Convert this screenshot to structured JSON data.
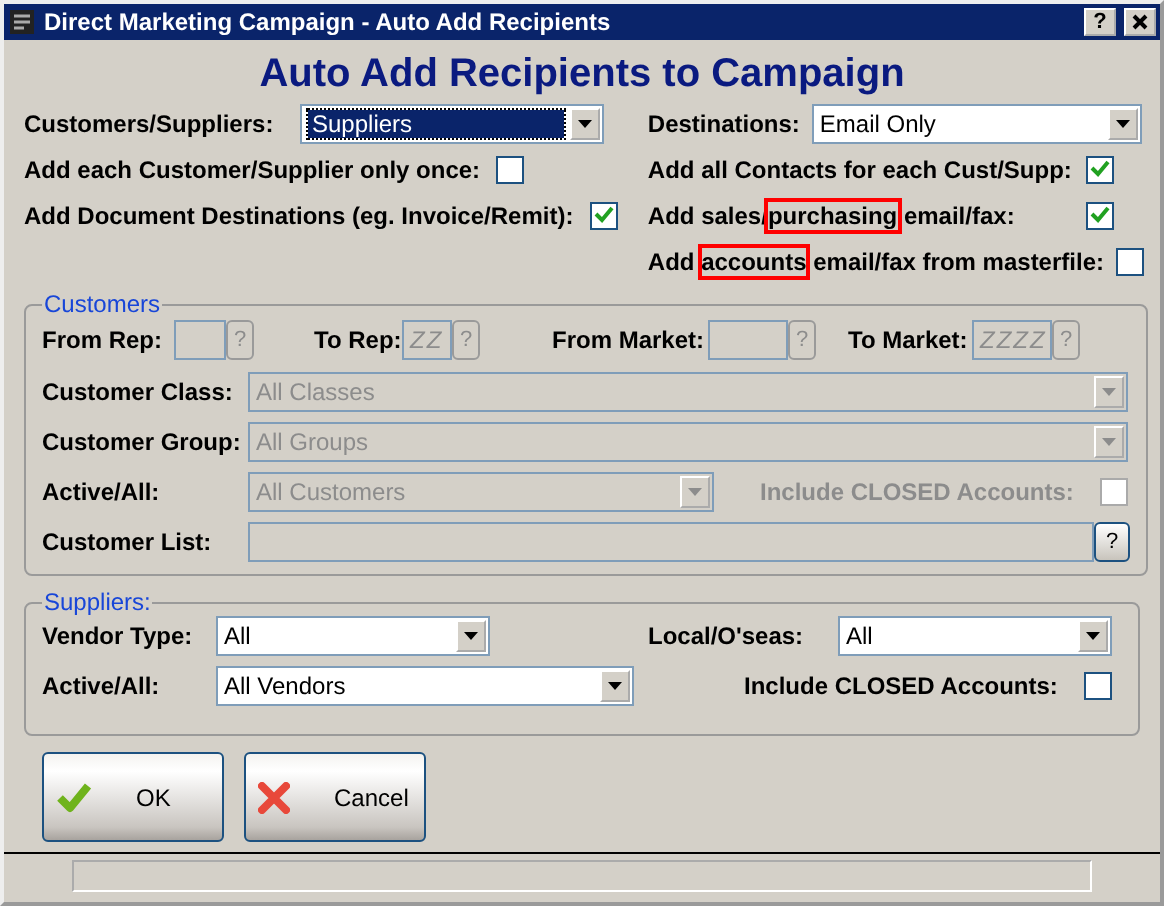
{
  "window": {
    "title": "Direct Marketing Campaign - Auto Add Recipients",
    "help": "?"
  },
  "heading": "Auto Add Recipients to Campaign",
  "options_left": [
    {
      "kind": "select",
      "label": "Customers/Suppliers:",
      "value": "Suppliers",
      "focused": true
    },
    {
      "kind": "checkbox",
      "label": "Add each Customer/Supplier only once:",
      "checked": false
    },
    {
      "kind": "checkbox",
      "label": "Add Document Destinations (eg. Invoice/Remit):",
      "checked": true
    }
  ],
  "options_right": [
    {
      "kind": "select",
      "label_parts": [
        {
          "text": "Destinations:",
          "highlighted": false
        }
      ],
      "value": "Email Only",
      "focused": false
    },
    {
      "kind": "checkbox",
      "label_parts": [
        {
          "text": "Add all Contacts for each Cust/Supp:",
          "highlighted": false
        }
      ],
      "checked": true
    },
    {
      "kind": "checkbox",
      "label_parts": [
        {
          "text": "Add sales/",
          "highlighted": false
        },
        {
          "text": "purchasing",
          "highlighted": true
        },
        {
          "text": " email/fax:",
          "highlighted": false
        }
      ],
      "checked": true
    },
    {
      "kind": "checkbox",
      "label_parts": [
        {
          "text": "Add ",
          "highlighted": false
        },
        {
          "text": "accounts",
          "highlighted": true
        },
        {
          "text": " email/fax from masterfile:",
          "highlighted": false
        }
      ],
      "checked": false
    }
  ],
  "customers": {
    "title": "Customers",
    "disabled": true,
    "ranges": [
      {
        "label": "From Rep:",
        "lookup": "?"
      },
      {
        "label": "To Rep:",
        "value": "ZZ",
        "lookup": "?"
      },
      {
        "label": "From Market:",
        "lookup": "?"
      },
      {
        "label": "To Market:",
        "value": "ZZZZ",
        "lookup": "?"
      }
    ],
    "customer_class": {
      "label": "Customer Class:",
      "value": "All Classes"
    },
    "customer_group": {
      "label": "Customer Group:",
      "value": "All Groups"
    },
    "active_all": {
      "label": "Active/All:",
      "value": "All Customers"
    },
    "include_closed": {
      "label": "Include CLOSED Accounts:",
      "checked": false
    },
    "customer_list": {
      "label": "Customer List:",
      "lookup": "?"
    }
  },
  "suppliers": {
    "title": "Suppliers:",
    "vendor_type": {
      "label": "Vendor Type:",
      "value": "All"
    },
    "local_overseas": {
      "label": "Local/O'seas:",
      "value": "All"
    },
    "active_all": {
      "label": "Active/All:",
      "value": "All Vendors"
    },
    "include_closed": {
      "label": "Include CLOSED Accounts:",
      "checked": false
    }
  },
  "buttons": [
    {
      "kind": "ok",
      "label": "OK"
    },
    {
      "kind": "cancel",
      "label": "Cancel"
    }
  ]
}
